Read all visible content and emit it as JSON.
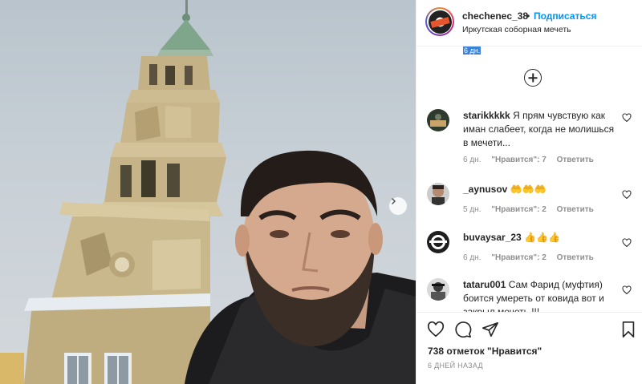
{
  "post": {
    "username": "chechenec_38",
    "dot": "•",
    "follow_label": "Подписаться",
    "location": "Иркутская соборная мечеть",
    "hidden_timestamp": "6 дн.",
    "likes": "738 отметок \"Нравится\"",
    "date": "6 ДНЕЙ НАЗАД"
  },
  "comments": [
    {
      "user": "starikkkkk",
      "text": "Я прям чувствую как иман слабеет, когда не молишься в мечети...",
      "time": "6 дн.",
      "likes": "\"Нравится\": 7",
      "reply": "Ответить"
    },
    {
      "user": "_aynusov",
      "text": "🤲🤲🤲",
      "time": "5 дн.",
      "likes": "\"Нравится\": 2",
      "reply": "Ответить"
    },
    {
      "user": "buvaysar_23",
      "text": "👍👍👍",
      "time": "6 дн.",
      "likes": "\"Нравится\": 2",
      "reply": "Ответить"
    },
    {
      "user": "tataru001",
      "text": "Сам Фарид (муфтия) боится умереть от ковида вот и закрыл мечеть !!!",
      "time": "",
      "likes": "",
      "reply": ""
    }
  ],
  "icons": {
    "like": "heart-icon",
    "comment": "comment-icon",
    "share": "share-icon",
    "save": "bookmark-icon",
    "next": "chevron-right-icon",
    "load_more": "plus-circle-icon"
  },
  "colors": {
    "accent": "#0095f6",
    "text": "#262626",
    "muted": "#8e8e8e"
  }
}
